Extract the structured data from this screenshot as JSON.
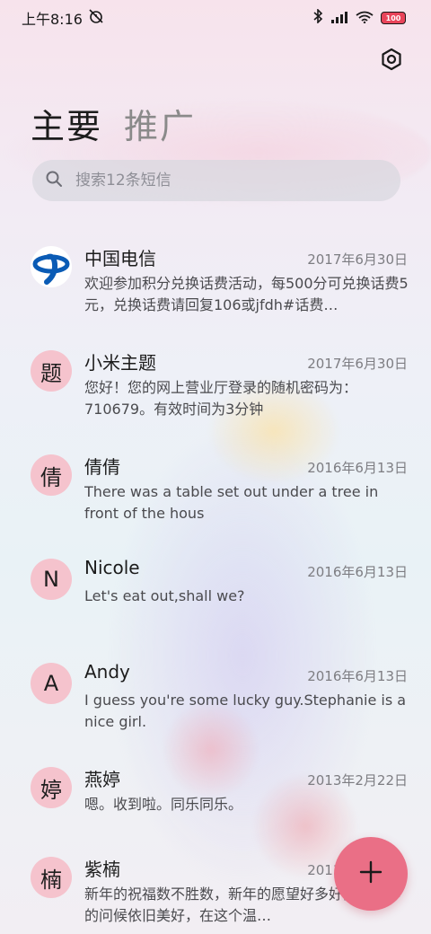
{
  "status_bar": {
    "time": "上午8:16",
    "battery": "100"
  },
  "tabs": [
    {
      "label": "主要",
      "active": true
    },
    {
      "label": "推广",
      "active": false
    }
  ],
  "search": {
    "placeholder": "搜索12条短信"
  },
  "conversations": [
    {
      "avatar": "",
      "avatar_type": "china-telecom-logo",
      "name": "中国电信",
      "date": "2017年6月30日",
      "snippet": "欢迎参加积分兑换话费活动，每500分可兑换话费5元，兑换话费请回复106或jfdh#话费…"
    },
    {
      "avatar": "题",
      "name": "小米主题",
      "date": "2017年6月30日",
      "snippet": "您好！您的网上营业厅登录的随机密码为：710679。有效时间为3分钟"
    },
    {
      "avatar": "倩",
      "name": "倩倩",
      "date": "2016年6月13日",
      "snippet": "There was a table set out under a tree in front of the hous"
    },
    {
      "avatar": "N",
      "name": "Nicole",
      "date": "2016年6月13日",
      "snippet": "Let's eat out,shall we?"
    },
    {
      "avatar": "A",
      "name": "Andy",
      "date": "2016年6月13日",
      "snippet": "I guess you're some lucky guy.Stephanie is a nice girl."
    },
    {
      "avatar": "婷",
      "name": "燕婷",
      "date": "2013年2月22日",
      "snippet": "嗯。收到啦。同乐同乐。"
    },
    {
      "avatar": "楠",
      "name": "紫楠",
      "date": "2013年2月22日",
      "snippet": "新年的祝福数不胜数，新年的愿望好多好多，新年的问候依旧美好，在这个温…"
    }
  ],
  "colors": {
    "avatar_bg": "#f5c3cd",
    "fab_bg": "#ea6f86",
    "battery_fill": "#e8445a"
  },
  "icons": {
    "settings": "settings-icon",
    "search": "search-icon",
    "compose": "plus-icon"
  }
}
